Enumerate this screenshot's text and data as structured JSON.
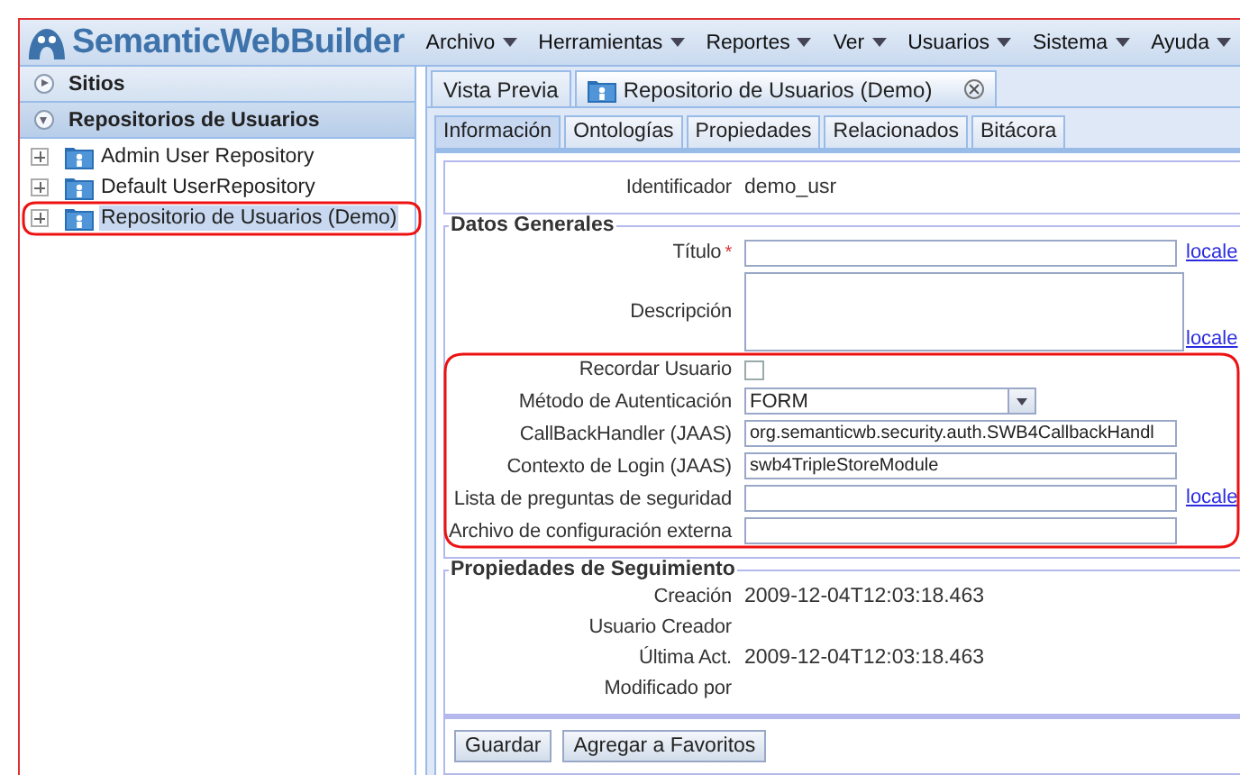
{
  "app": {
    "title": "SemanticWebBuilder"
  },
  "menu": [
    {
      "label": "Archivo"
    },
    {
      "label": "Herramientas"
    },
    {
      "label": "Reportes"
    },
    {
      "label": "Ver"
    },
    {
      "label": "Usuarios"
    },
    {
      "label": "Sistema"
    },
    {
      "label": "Ayuda"
    }
  ],
  "sidebar": {
    "sections": [
      {
        "label": "Sitios",
        "expanded": false
      },
      {
        "label": "Repositorios de Usuarios",
        "expanded": true
      }
    ],
    "tree": [
      {
        "label": "Admin User Repository",
        "selected": false
      },
      {
        "label": "Default UserRepository",
        "selected": false
      },
      {
        "label": "Repositorio de Usuarios (Demo)",
        "selected": true
      }
    ]
  },
  "tabs": [
    {
      "label": "Vista Previa",
      "selected": false,
      "closable": false
    },
    {
      "label": "Repositorio de Usuarios (Demo)",
      "selected": true,
      "closable": true
    }
  ],
  "subtabs": [
    {
      "label": "Información",
      "selected": true
    },
    {
      "label": "Ontologías",
      "selected": false
    },
    {
      "label": "Propiedades",
      "selected": false
    },
    {
      "label": "Relacionados",
      "selected": false
    },
    {
      "label": "Bitácora",
      "selected": false
    }
  ],
  "identifier": {
    "label": "Identificador",
    "value": "demo_usr"
  },
  "fieldsets": [
    {
      "legend": "Datos Generales",
      "fields": [
        {
          "kind": "text",
          "label": "Título",
          "required": true,
          "required_mark": "*",
          "link": "locale"
        },
        {
          "kind": "textarea",
          "label": "Descripción",
          "required": false,
          "link": "locale"
        },
        {
          "kind": "checkbox",
          "label": "Recordar Usuario",
          "required": false,
          "checked": false
        },
        {
          "kind": "select",
          "label": "Método de Autenticación",
          "required": false,
          "value": "FORM"
        },
        {
          "kind": "text",
          "label": "CallBackHandler (JAAS)",
          "required": false,
          "value": "org.semanticwb.security.auth.SWB4CallbackHandl"
        },
        {
          "kind": "text",
          "label": "Contexto de Login (JAAS)",
          "required": false,
          "value": "swb4TripleStoreModule"
        },
        {
          "kind": "text",
          "label": "Lista de preguntas de seguridad",
          "required": false,
          "link": "locale"
        },
        {
          "kind": "text",
          "label": "Archivo de configuración externa",
          "required": false
        }
      ]
    },
    {
      "legend": "Propiedades de Seguimiento",
      "fields": [
        {
          "kind": "static",
          "label": "Creación",
          "required": false,
          "value": "2009-12-04T12:03:18.463"
        },
        {
          "kind": "static",
          "label": "Usuario Creador",
          "required": false
        },
        {
          "kind": "static",
          "label": "Última Act.",
          "required": false,
          "value": "2009-12-04T12:03:18.463"
        },
        {
          "kind": "static",
          "label": "Modificado por",
          "required": false
        }
      ]
    }
  ],
  "buttons": [
    {
      "label": "Guardar"
    },
    {
      "label": "Agregar a Favoritos"
    }
  ]
}
